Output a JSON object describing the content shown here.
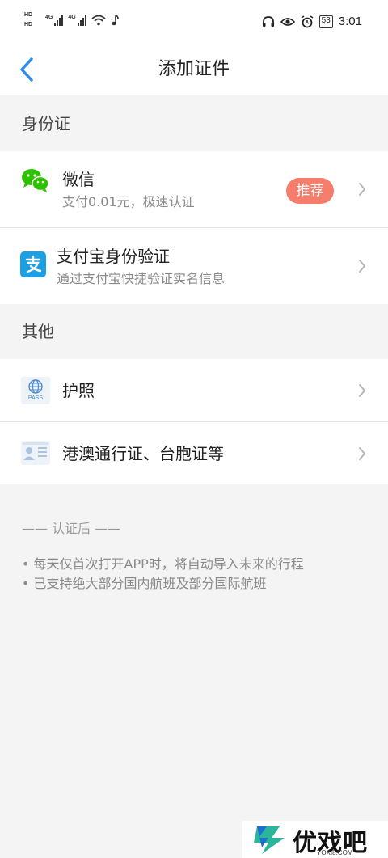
{
  "status_bar": {
    "hd1": "HD",
    "hd2": "HD",
    "sig1": "4G",
    "sig2": "4G",
    "battery": "53",
    "time": "3:01"
  },
  "nav": {
    "title": "添加证件"
  },
  "sections": {
    "id_card": "身份证",
    "other": "其他"
  },
  "rows": {
    "wechat": {
      "title": "微信",
      "subtitle": "支付0.01元，极速认证",
      "badge": "推荐"
    },
    "alipay": {
      "title": "支付宝身份验证",
      "subtitle": "通过支付宝快捷验证实名信息"
    },
    "passport": {
      "title": "护照",
      "icon_text": "PASS"
    },
    "hk_macau": {
      "title": "港澳通行证、台胞证等"
    }
  },
  "notes": {
    "heading": "—— 认证后 ——",
    "items": [
      "• 每天仅首次打开APP时，将自动导入未来的行程",
      "• 已支持绝大部分国内航班及部分国际航班"
    ]
  },
  "watermark": {
    "text": "优戏吧",
    "url": "YOXI8.COM"
  },
  "colors": {
    "accent_blue": "#2f8cf0",
    "badge": "#f47d6b",
    "wechat_green": "#2dc100",
    "alipay_blue": "#1ca0e3"
  }
}
